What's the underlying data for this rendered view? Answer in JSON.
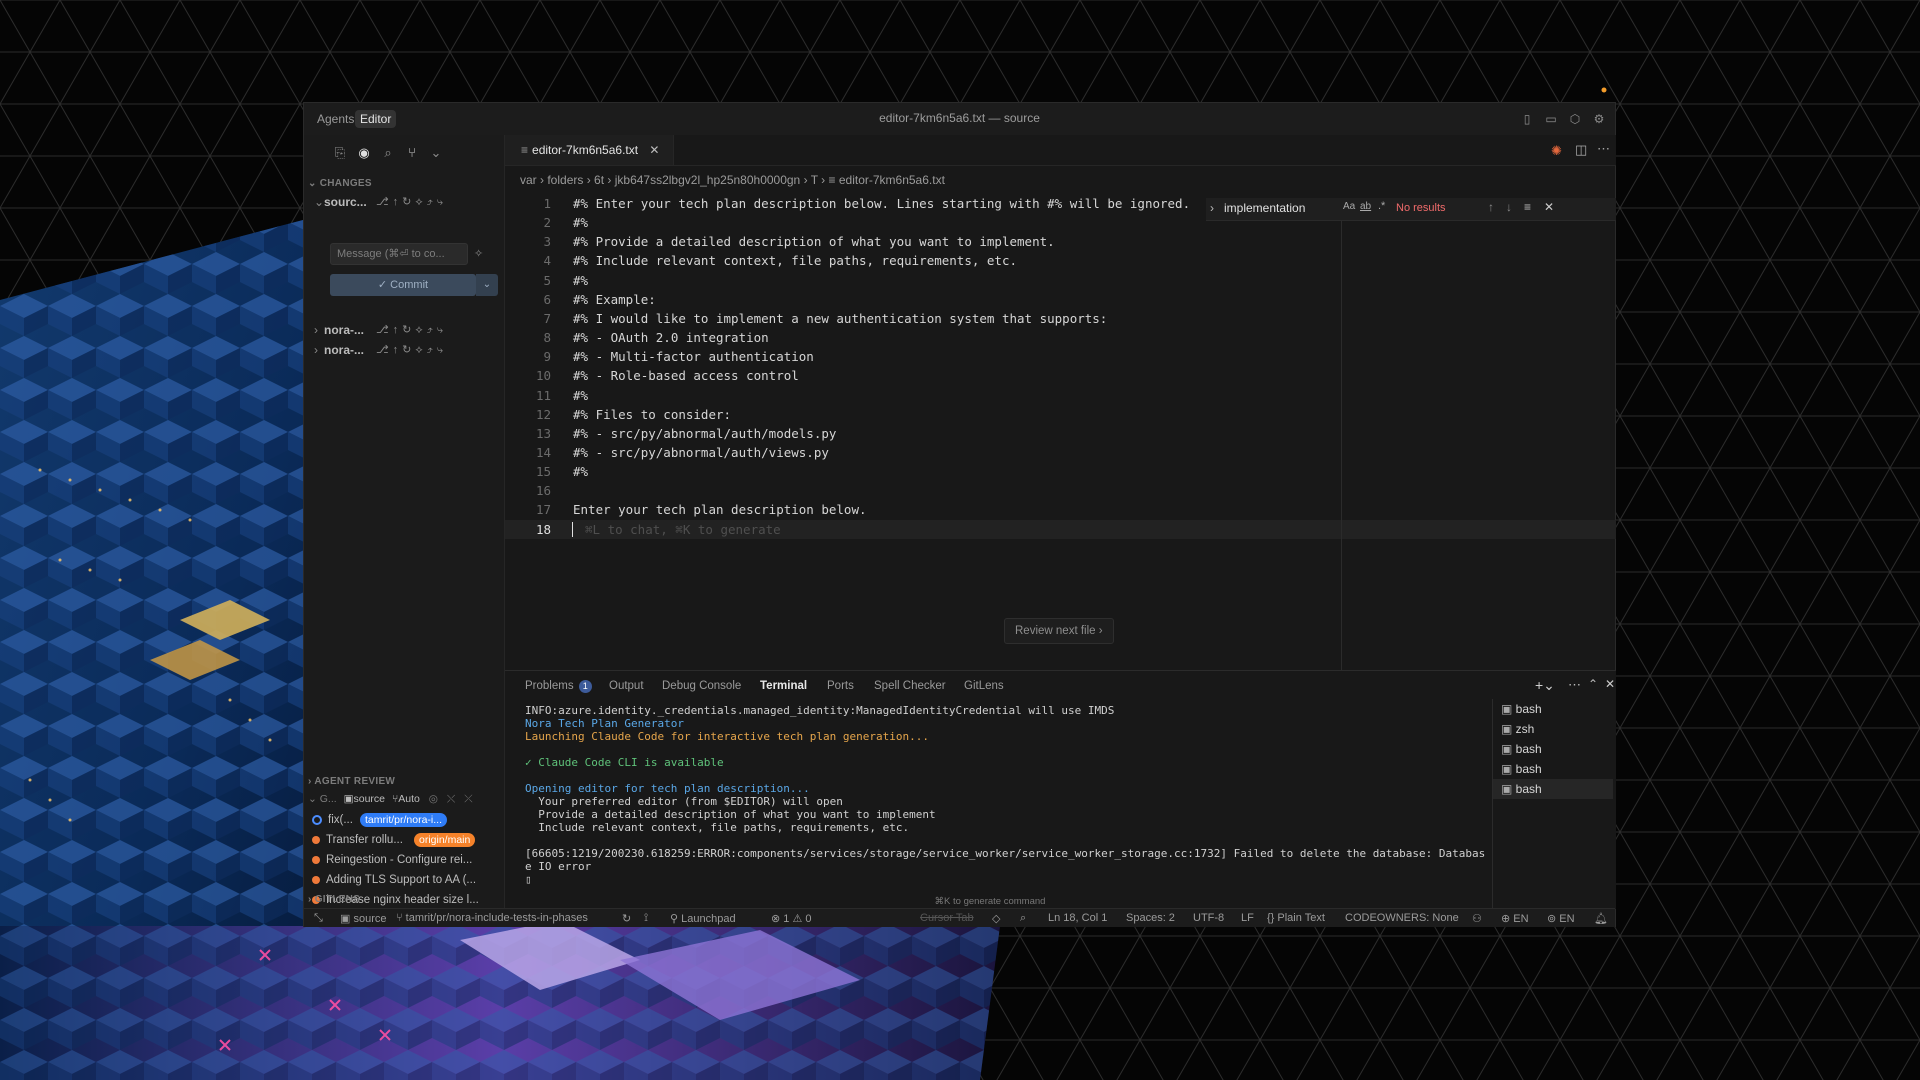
{
  "window": {
    "title": "editor-7km6n5a6.txt — source"
  },
  "mode_tabs": {
    "agents": "Agents",
    "editor": "Editor"
  },
  "sidebar": {
    "changes_header": "CHANGES",
    "repo_source": "sourc...",
    "message_placeholder": "Message (⌘⏎ to co...",
    "commit_label": "✓ Commit",
    "repos": [
      "nora-...",
      "nora-..."
    ],
    "agent_review_header": "AGENT REVIEW",
    "graph": {
      "label": "G...",
      "repo": "source",
      "mode": "Auto"
    },
    "commits": [
      {
        "text": "fix(...",
        "badge": "tamrit/pr/nora-i...",
        "badge_color": "#2f7cf6",
        "dot": "#4c8dff"
      },
      {
        "text": "Transfer rollu...",
        "badge": "origin/main",
        "badge_color": "#f5822a",
        "dot": "#f07a3a"
      },
      {
        "text": "Reingestion - Configure rei...",
        "dot": "#f07a3a"
      },
      {
        "text": "Adding TLS Support to AA (...",
        "dot": "#f07a3a"
      },
      {
        "text": "Increase nginx header size l...",
        "dot": "#f07a3a"
      },
      {
        "text": "Resolve vite/vitest version c...",
        "dot": "#f07a3a"
      }
    ],
    "gitlens_header": "GITLENS"
  },
  "editor": {
    "tab": "editor-7km6n5a6.txt",
    "breadcrumb": [
      "var",
      "folders",
      "6t",
      "jkb647ss2lbgv2l_hp25n80h0000gn",
      "T",
      "editor-7km6n5a6.txt"
    ],
    "lines": [
      "#% Enter your tech plan description below. Lines starting with #% will be ignored.",
      "#%",
      "#% Provide a detailed description of what you want to implement.",
      "#% Include relevant context, file paths, requirements, etc.",
      "#%",
      "#% Example:",
      "#% I would like to implement a new authentication system that supports:",
      "#% - OAuth 2.0 integration",
      "#% - Multi-factor authentication",
      "#% - Role-based access control",
      "#%",
      "#% Files to consider:",
      "#% - src/py/abnormal/auth/models.py",
      "#% - src/py/abnormal/auth/views.py",
      "#%",
      "",
      "Enter your tech plan description below.",
      ""
    ],
    "line_numbers": [
      "1",
      "2",
      "3",
      "4",
      "5",
      "6",
      "7",
      "8",
      "9",
      "10",
      "11",
      "12",
      "13",
      "14",
      "15",
      "16",
      "17",
      "18"
    ],
    "ghost_hint": "⌘L to chat, ⌘K to generate",
    "find": {
      "query": "implementation",
      "result": "No results"
    },
    "review_next": "Review next file"
  },
  "panel": {
    "tabs": [
      "Problems",
      "Output",
      "Debug Console",
      "Terminal",
      "Ports",
      "Spell Checker",
      "GitLens"
    ],
    "problems_count": "1",
    "terminal_lines": [
      {
        "t": "INFO:azure.identity._credentials.managed_identity:ManagedIdentityCredential will use IMDS",
        "c": "#d0d0d0"
      },
      {
        "t": "Nora Tech Plan Generator",
        "c": "#5aa7e6"
      },
      {
        "t": "Launching Claude Code for interactive tech plan generation...",
        "c": "#e5a54b"
      },
      {
        "t": "",
        "c": "#d0d0d0"
      },
      {
        "t": "✓ Claude Code CLI is available",
        "c": "#5fc27a"
      },
      {
        "t": "",
        "c": "#d0d0d0"
      },
      {
        "t": "Opening editor for tech plan description...",
        "c": "#5aa7e6"
      },
      {
        "t": "  Your preferred editor (from $EDITOR) will open",
        "c": "#d0d0d0"
      },
      {
        "t": "  Provide a detailed description of what you want to implement",
        "c": "#d0d0d0"
      },
      {
        "t": "  Include relevant context, file paths, requirements, etc.",
        "c": "#d0d0d0"
      },
      {
        "t": "",
        "c": "#d0d0d0"
      },
      {
        "t": "[66605:1219/200230.618259:ERROR:components/services/storage/service_worker/service_worker_storage.cc:1732] Failed to delete the database: Databas",
        "c": "#d0d0d0"
      },
      {
        "t": "e IO error",
        "c": "#d0d0d0"
      },
      {
        "t": "▯",
        "c": "#d0d0d0"
      }
    ],
    "shells": [
      "bash",
      "zsh",
      "bash",
      "bash",
      "bash"
    ],
    "generate_hint": "⌘K to generate command"
  },
  "status": {
    "repo": "source",
    "branch": "tamrit/pr/nora-include-tests-in-phases",
    "launchpad": "Launchpad",
    "problems": "⊗ 1 ⚠ 0",
    "cursor_tab": "Cursor Tab",
    "position": "Ln 18, Col 1",
    "spaces": "Spaces: 2",
    "encoding": "UTF-8",
    "eol": "LF",
    "language": "{} Plain Text",
    "codeowners": "CODEOWNERS: None",
    "lang1": "EN",
    "lang2": "EN"
  }
}
